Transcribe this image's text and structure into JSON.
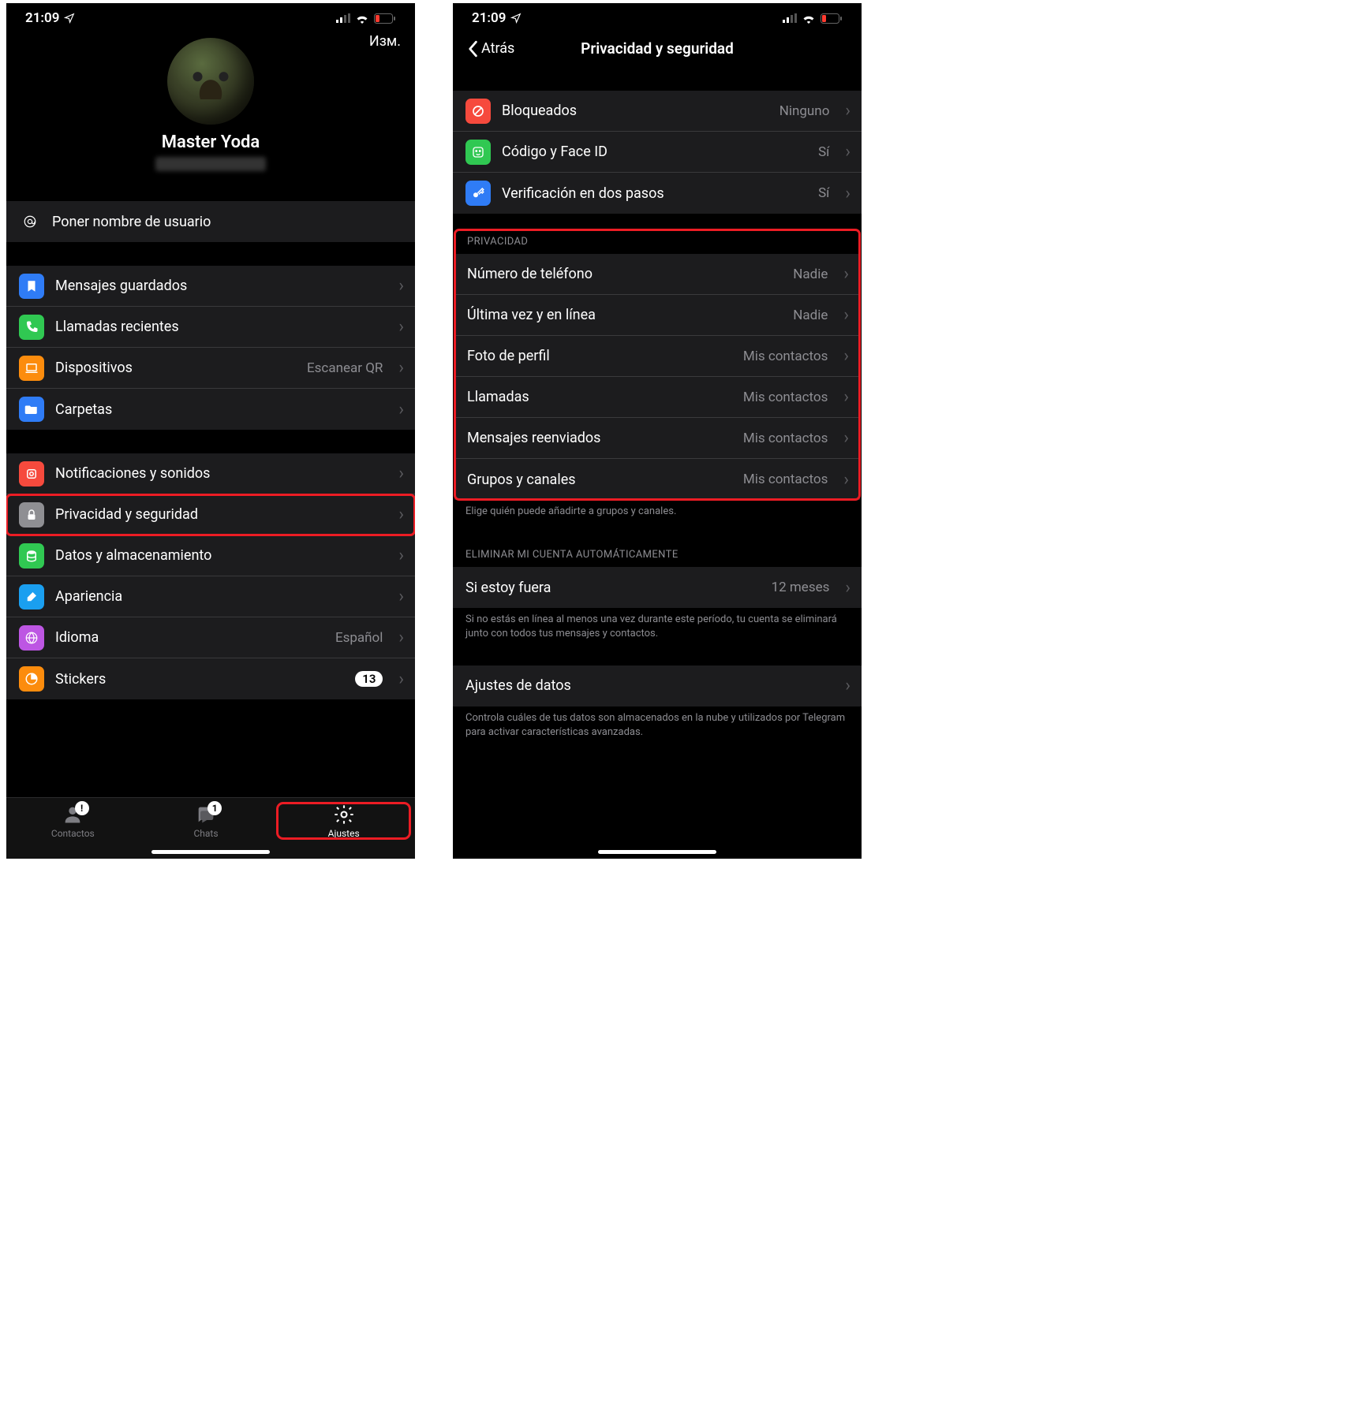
{
  "statusTime": "21:09",
  "left": {
    "editLabel": "Изм.",
    "profileName": "Master Yoda",
    "usernameRow": "Poner nombre de usuario",
    "section1": [
      {
        "icon": "bookmark",
        "bg": "#2f7cf6",
        "label": "Mensajes guardados"
      },
      {
        "icon": "phone",
        "bg": "#30c852",
        "label": "Llamadas recientes"
      },
      {
        "icon": "laptop",
        "bg": "#fc8c0d",
        "label": "Dispositivos",
        "value": "Escanear QR"
      },
      {
        "icon": "folder",
        "bg": "#2f7cf6",
        "label": "Carpetas"
      }
    ],
    "section2": [
      {
        "icon": "bell",
        "bg": "#f64a3d",
        "label": "Notificaciones y sonidos"
      },
      {
        "icon": "lock",
        "bg": "#8f8f93",
        "label": "Privacidad y seguridad",
        "highlight": true
      },
      {
        "icon": "db",
        "bg": "#30c852",
        "label": "Datos y almacenamiento"
      },
      {
        "icon": "brush",
        "bg": "#1a9ff0",
        "label": "Apariencia"
      },
      {
        "icon": "globe",
        "bg": "#bd56e3",
        "label": "Idioma",
        "value": "Español"
      },
      {
        "icon": "sticker",
        "bg": "#fc8c0d",
        "label": "Stickers",
        "badge": "13"
      }
    ],
    "tabs": {
      "contactos": "Contactos",
      "chats": "Chats",
      "chatsBadge": "1",
      "ajustes": "Ajustes"
    }
  },
  "right": {
    "back": "Atrás",
    "title": "Privacidad y seguridad",
    "security": [
      {
        "icon": "block",
        "bg": "#f64a3d",
        "label": "Bloqueados",
        "value": "Ninguno"
      },
      {
        "icon": "face",
        "bg": "#30c852",
        "label": "Código y Face ID",
        "value": "Sí"
      },
      {
        "icon": "key",
        "bg": "#2f7cf6",
        "label": "Verificación en dos pasos",
        "value": "Sí"
      }
    ],
    "privacyHeader": "PRIVACIDAD",
    "privacy": [
      {
        "label": "Número de teléfono",
        "value": "Nadie"
      },
      {
        "label": "Última vez y en línea",
        "value": "Nadie"
      },
      {
        "label": "Foto de perfil",
        "value": "Mis contactos"
      },
      {
        "label": "Llamadas",
        "value": "Mis contactos"
      },
      {
        "label": "Mensajes reenviados",
        "value": "Mis contactos"
      },
      {
        "label": "Grupos y canales",
        "value": "Mis contactos"
      }
    ],
    "privacyFooter": "Elige quién puede añadirte a grupos y canales.",
    "deleteHeader": "ELIMINAR MI CUENTA AUTOMÁTICAMENTE",
    "delete": {
      "label": "Si estoy fuera",
      "value": "12 meses"
    },
    "deleteFooter": "Si no estás en línea al menos una vez durante este período, tu cuenta se eliminará junto con todos tus mensajes y contactos.",
    "dataSettings": {
      "label": "Ajustes de datos"
    },
    "dataFooter": "Controla cuáles de tus datos son almacenados en la nube y utilizados por Telegram para activar características avanzadas."
  }
}
